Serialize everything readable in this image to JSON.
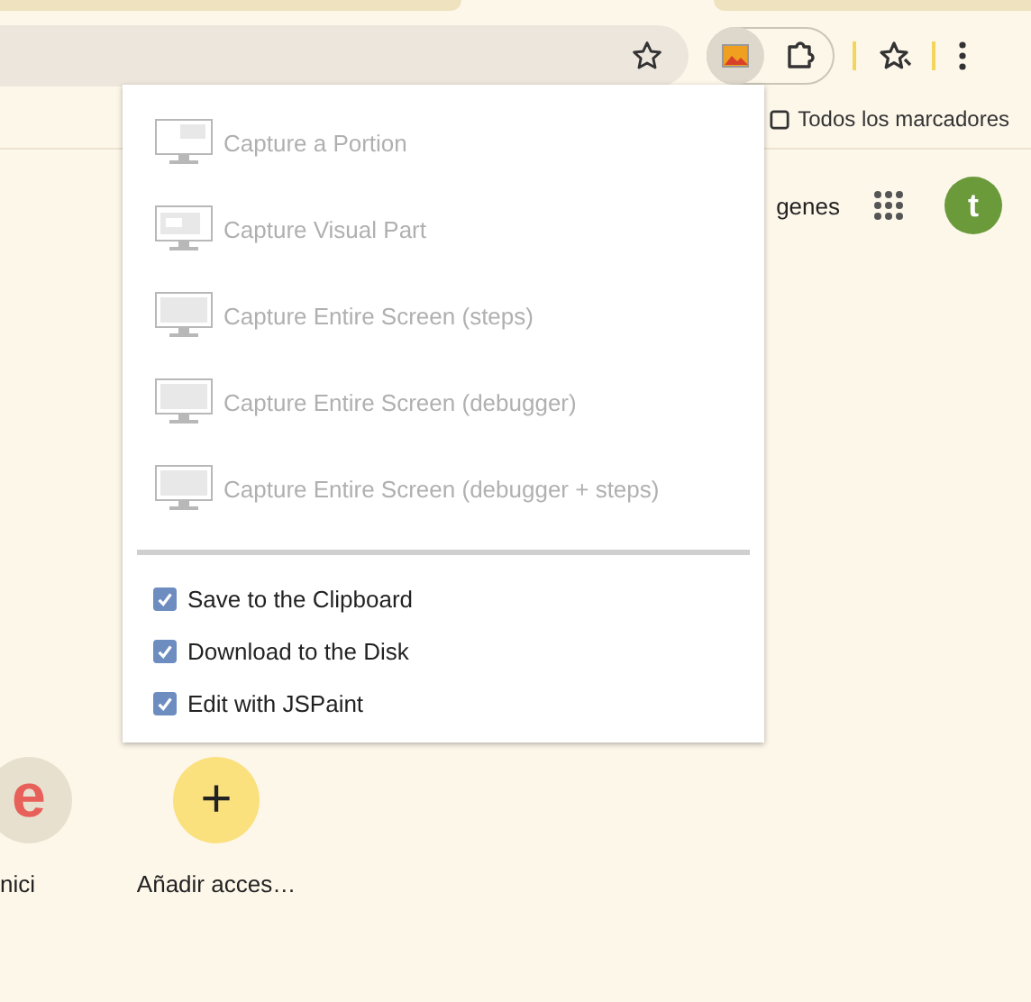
{
  "bookmarks_bar": {
    "all_bookmarks": "Todos los marcadores"
  },
  "header": {
    "link_partial": "genes",
    "avatar_letter": "t"
  },
  "capture_menu": {
    "items": [
      {
        "label": "Capture a Portion",
        "kind": "portion",
        "disabled": true
      },
      {
        "label": "Capture Visual Part",
        "kind": "visual",
        "disabled": true
      },
      {
        "label": "Capture Entire Screen (steps)",
        "kind": "entire",
        "disabled": true
      },
      {
        "label": "Capture Entire Screen (debugger)",
        "kind": "entire",
        "disabled": true
      },
      {
        "label": "Capture Entire Screen (debugger + steps)",
        "kind": "entire",
        "disabled": true
      }
    ],
    "options": [
      {
        "label": "Save to the Clipboard",
        "checked": true
      },
      {
        "label": "Download to the Disk",
        "checked": true
      },
      {
        "label": "Edit with JSPaint",
        "checked": true
      }
    ]
  },
  "shortcuts": [
    {
      "kind": "site",
      "letter": "e",
      "label": "nici"
    },
    {
      "kind": "add",
      "letter": "+",
      "label": "Añadir acces…"
    }
  ]
}
